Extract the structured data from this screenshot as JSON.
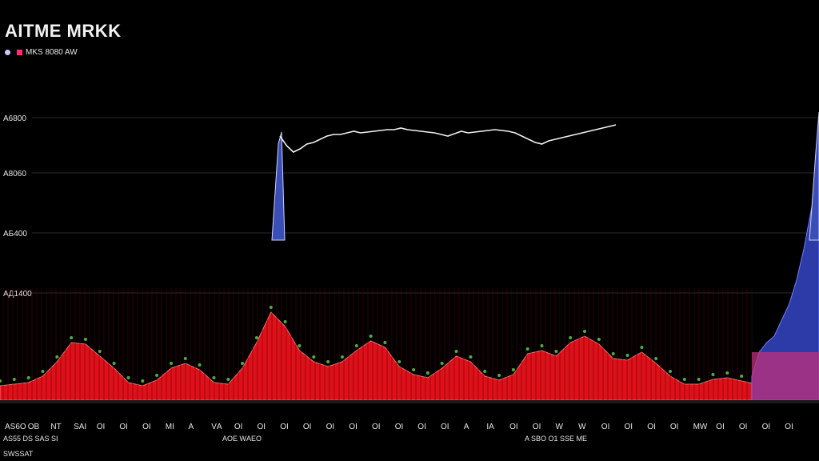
{
  "chart_data": {
    "type": "area",
    "title": "AITME MRKK",
    "legend": {
      "items": [
        {
          "label": "MKS 8080 AW",
          "color": "#ff2a7a"
        }
      ],
      "placement": "top-left"
    },
    "y_tick_labels": [
      "A6800",
      "A8060",
      "AБ400",
      "AД1400"
    ],
    "x_tick_labels": [
      "AS6O",
      "OB",
      "NT",
      "SAI",
      "OI",
      "OI",
      "OI",
      "MI",
      "A",
      "VА",
      "OI",
      "OI",
      "OI",
      "OI",
      "OI",
      "OI",
      "OI",
      "OI",
      "OI",
      "OI",
      "A",
      "IA",
      "OI",
      "OI",
      "W",
      "W",
      "OI",
      "OI",
      "OI",
      "OI",
      "MW",
      "OI",
      "OI",
      "OI",
      "OI"
    ],
    "bottom_labels": [
      "AS55 DS SAS SI",
      "AОЕ WАЕО",
      "A SBO O1 SSE ME"
    ],
    "footer_label": "SWSSAT",
    "grid": true,
    "colors": {
      "area_main": "#e0101a",
      "area_right": "#2d3ba8",
      "line": "#f0f0f0",
      "markers": "#4caf3a",
      "grid": "#2a2a2a",
      "baseline": "#1a1a1a"
    },
    "series": [
      {
        "type": "area",
        "values": [
          18,
          20,
          22,
          30,
          48,
          72,
          70,
          55,
          40,
          22,
          18,
          25,
          40,
          46,
          38,
          22,
          20,
          40,
          72,
          110,
          92,
          62,
          48,
          42,
          48,
          62,
          74,
          66,
          42,
          32,
          28,
          40,
          55,
          48,
          30,
          25,
          32,
          58,
          62,
          55,
          72,
          80,
          70,
          52,
          50,
          60,
          46,
          30,
          20,
          20,
          26,
          28,
          24,
          20
        ]
      },
      {
        "type": "area_right",
        "values": [
          30,
          60,
          72,
          80,
          100,
          120,
          150,
          190,
          240,
          270
        ]
      },
      {
        "type": "line",
        "x": [
          0.0,
          0.02,
          0.04,
          0.06,
          0.08,
          0.1,
          0.12,
          0.14,
          0.16,
          0.18,
          0.2,
          0.22,
          0.24,
          0.26,
          0.28,
          0.3,
          0.32,
          0.34,
          0.36,
          0.38,
          0.4,
          0.42,
          0.44,
          0.46,
          0.48,
          0.5,
          0.52,
          0.54,
          0.56,
          0.58,
          0.6,
          0.62,
          0.64,
          0.66,
          0.68,
          0.7,
          0.72,
          0.74,
          0.76,
          0.78,
          0.8,
          0.82,
          0.84,
          0.86,
          0.88,
          0.9,
          0.92,
          0.94,
          0.96,
          0.98,
          1.0
        ],
        "values": [
          330,
          318,
          310,
          314,
          320,
          322,
          326,
          330,
          332,
          332,
          334,
          336,
          334,
          335,
          336,
          337,
          338,
          338,
          340,
          338,
          337,
          336,
          335,
          334,
          332,
          330,
          333,
          336,
          334,
          335,
          336,
          337,
          338,
          337,
          336,
          334,
          330,
          326,
          322,
          320,
          324,
          326,
          328,
          330,
          332,
          334,
          336,
          338,
          340,
          342,
          344
        ]
      }
    ]
  }
}
